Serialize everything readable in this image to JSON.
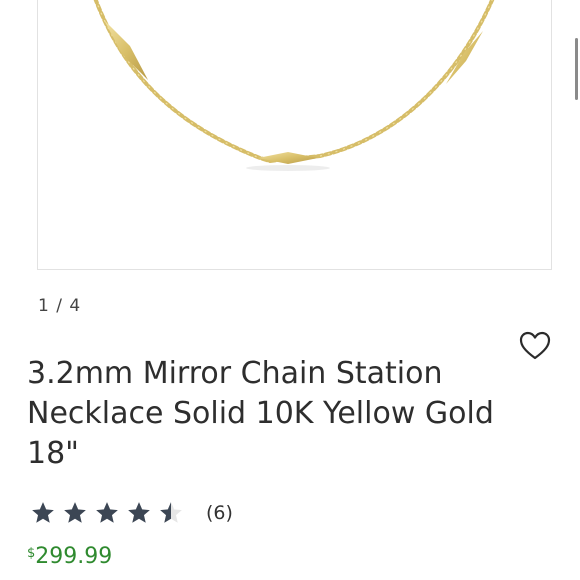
{
  "gallery": {
    "pager": "1 / 4",
    "image_alt": "Mirror chain station necklace in yellow gold"
  },
  "product": {
    "title": "3.2mm Mirror Chain Station Necklace Solid 10K Yellow Gold 18\"",
    "rating": 4.5,
    "max_rating": 5,
    "review_count": "(6)",
    "currency_symbol": "$",
    "price": "299.99"
  },
  "icons": {
    "wishlist": "heart-outline-icon",
    "star": "star-icon"
  },
  "colors": {
    "star_filled": "#3c4654",
    "star_empty": "#e6e6e6",
    "price": "#2f8a2f",
    "gold": "#d9c06a"
  }
}
